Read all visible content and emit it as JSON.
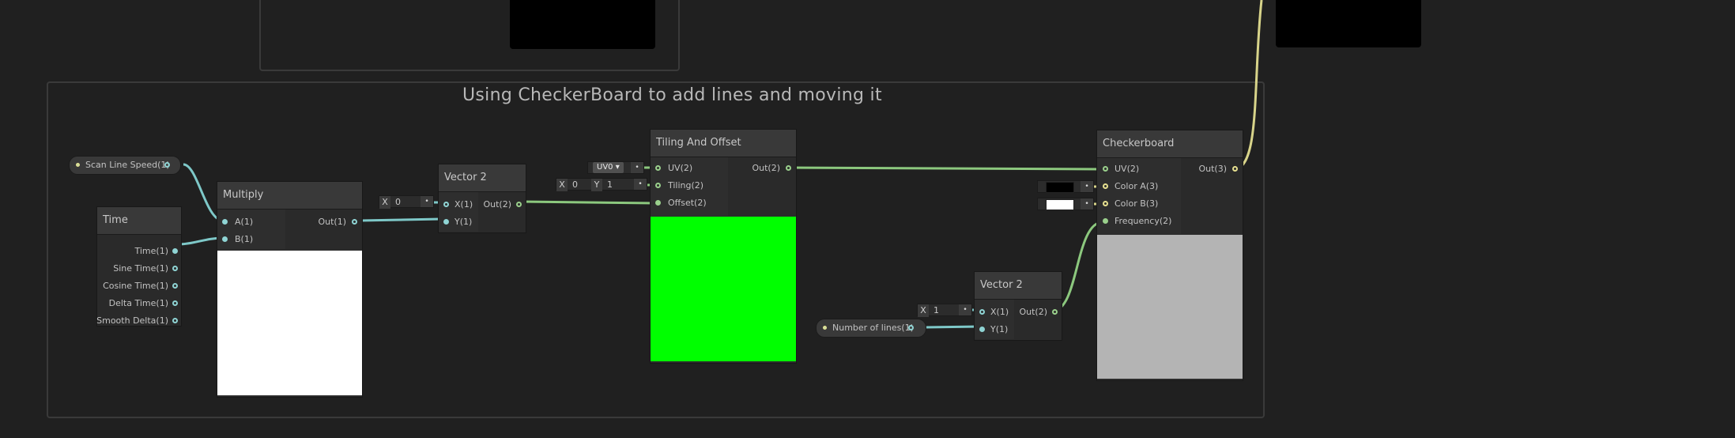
{
  "group": {
    "title": "Using CheckerBoard to add lines and moving it"
  },
  "properties": {
    "scan_line_speed": "Scan Line Speed(1)",
    "number_of_lines": "Number of lines(1)"
  },
  "time_node": {
    "title": "Time",
    "outputs": [
      "Time(1)",
      "Sine Time(1)",
      "Cosine Time(1)",
      "Delta Time(1)",
      "Smooth Delta(1)"
    ]
  },
  "multiply_node": {
    "title": "Multiply",
    "inputs": [
      "A(1)",
      "B(1)"
    ],
    "output": "Out(1)",
    "preview_color": "#ffffff"
  },
  "vector2_a": {
    "title": "Vector 2",
    "inputs": [
      "X(1)",
      "Y(1)"
    ],
    "output": "Out(2)",
    "x_axis": "X",
    "x_value": "0"
  },
  "tiling_node": {
    "title": "Tiling And Offset",
    "inputs": [
      "UV(2)",
      "Tiling(2)",
      "Offset(2)"
    ],
    "output": "Out(2)",
    "uv_dropdown": "UV0",
    "tiling_x_axis": "X",
    "tiling_x": "0",
    "tiling_y_axis": "Y",
    "tiling_y": "1",
    "preview_color": "#00ff00"
  },
  "vector2_b": {
    "title": "Vector 2",
    "inputs": [
      "X(1)",
      "Y(1)"
    ],
    "output": "Out(2)",
    "x_axis": "X",
    "x_value": "1"
  },
  "checker_node": {
    "title": "Checkerboard",
    "inputs": [
      "UV(2)",
      "Color A(3)",
      "Color B(3)",
      "Frequency(2)"
    ],
    "output": "Out(3)",
    "color_a": "#000000",
    "color_b": "#ffffff",
    "preview_color": "#b4b4b4"
  },
  "colors": {
    "wire_float": "#7ec8c8",
    "wire_vector2": "#8cc87e",
    "wire_vector3": "#d8d48a",
    "background": "#202020"
  }
}
